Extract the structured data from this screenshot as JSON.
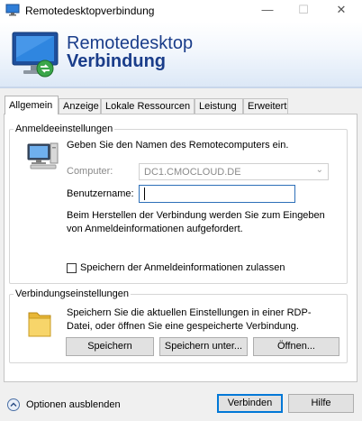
{
  "window": {
    "title": "Remotedesktopverbindung",
    "controls": {
      "minimize": "—",
      "maximize": "☐",
      "close": "✕"
    }
  },
  "banner": {
    "line1": "Remotedesktop",
    "line2": "Verbindung",
    "icon": "remote-desktop-monitor-icon"
  },
  "tabs": [
    {
      "label": "Allgemein",
      "active": true
    },
    {
      "label": "Anzeige",
      "active": false
    },
    {
      "label": "Lokale Ressourcen",
      "active": false
    },
    {
      "label": "Leistung",
      "active": false
    },
    {
      "label": "Erweitert",
      "active": false
    }
  ],
  "login_group": {
    "legend": "Anmeldeeinstellungen",
    "intro": "Geben Sie den Namen des Remotecomputers ein.",
    "computer_label": "Computer:",
    "computer_value": "DC1.CMOCLOUD.DE",
    "username_label": "Benutzername:",
    "username_value": "",
    "info": "Beim Herstellen der Verbindung werden Sie zum Eingeben von Anmeldeinformationen aufgefordert.",
    "save_creds_label": "Speichern der Anmeldeinformationen zulassen",
    "save_creds_checked": false,
    "icon": "computer-icon"
  },
  "connection_group": {
    "legend": "Verbindungseinstellungen",
    "text": "Speichern Sie die aktuellen Einstellungen in einer RDP-Datei, oder öffnen Sie eine gespeicherte Verbindung.",
    "buttons": {
      "save": "Speichern",
      "save_as": "Speichern unter...",
      "open": "Öffnen..."
    },
    "icon": "folder-icon"
  },
  "footer": {
    "options_label": "Optionen ausblenden",
    "connect": "Verbinden",
    "help": "Hilfe"
  },
  "colors": {
    "accent": "#0078d7",
    "banner_text": "#1a3d8a"
  }
}
